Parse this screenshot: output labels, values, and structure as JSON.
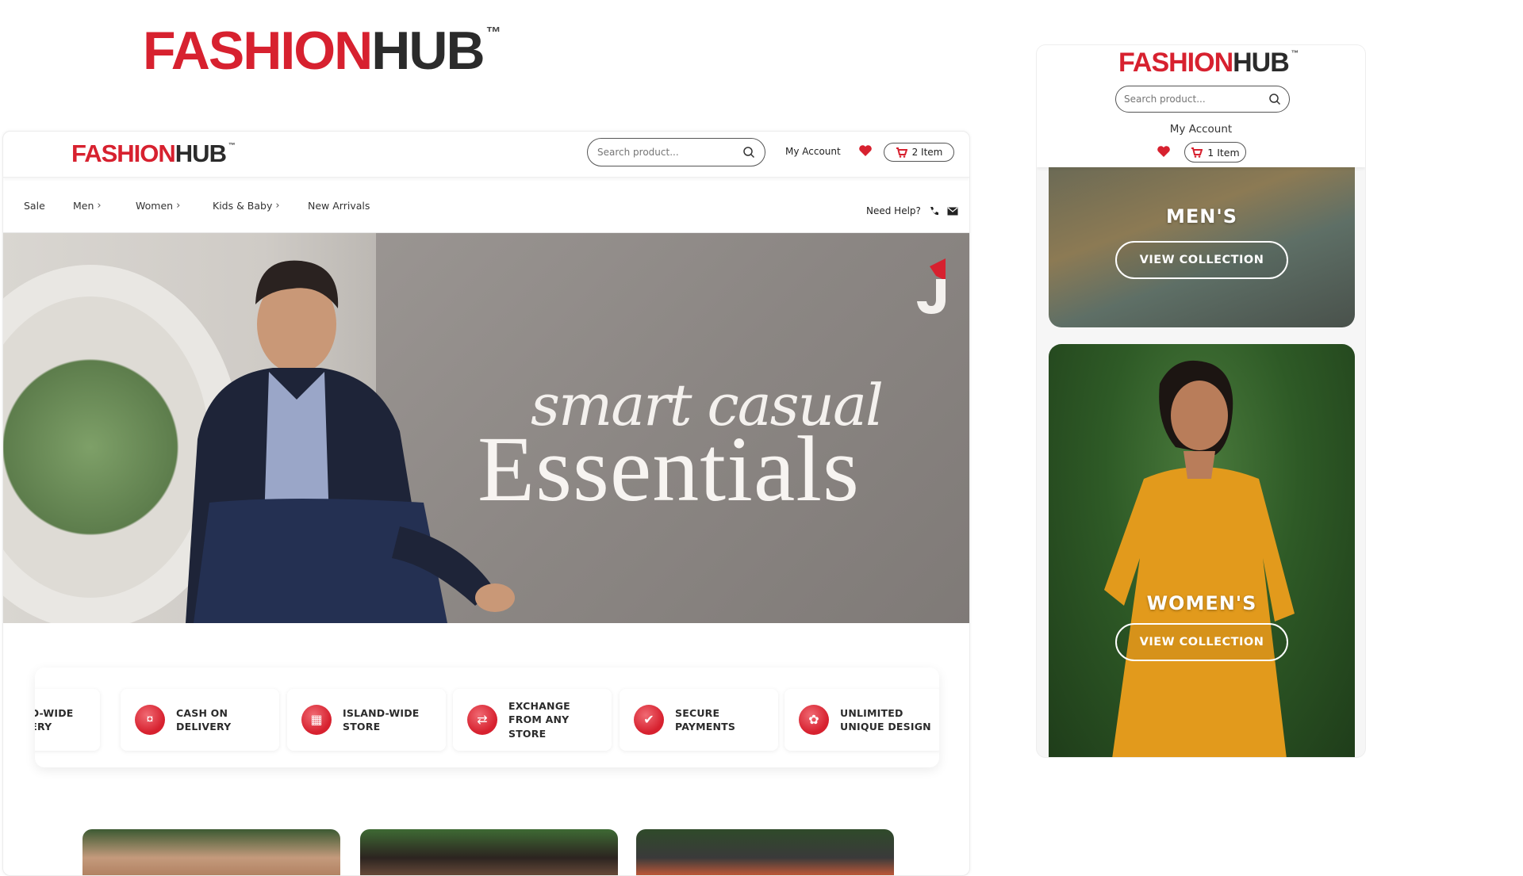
{
  "brand": {
    "logo_red": "FASHION",
    "logo_dark": "HUB",
    "tm": "™"
  },
  "desktop": {
    "search": {
      "placeholder": "Search product..."
    },
    "account_label": "My Account",
    "cart_label": "2 Item",
    "nav": {
      "items": [
        {
          "label": "Sale",
          "has_chevron": false
        },
        {
          "label": "Men",
          "has_chevron": true
        },
        {
          "label": "Women",
          "has_chevron": true
        },
        {
          "label": "Kids & Baby",
          "has_chevron": true
        },
        {
          "label": "New Arrivals",
          "has_chevron": false
        }
      ],
      "need_help": "Need Help?"
    },
    "hero": {
      "script_line": "smart casual",
      "headline": "Essentials"
    },
    "features": [
      {
        "label": "ISLAND-WIDE DELIVERY",
        "icon": "delivery-icon"
      },
      {
        "label": "CASH ON DELIVERY",
        "icon": "cash-icon"
      },
      {
        "label": "ISLAND-WIDE STORE",
        "icon": "store-icon"
      },
      {
        "label": "EXCHANGE FROM ANY STORE",
        "icon": "exchange-icon"
      },
      {
        "label": "SECURE PAYMENTS",
        "icon": "secure-payment-icon"
      },
      {
        "label": "UNLIMITED UNIQUE DESIGN",
        "icon": "design-icon"
      }
    ]
  },
  "mobile": {
    "search": {
      "placeholder": "Search product..."
    },
    "account_label": "My Account",
    "cart_label": "1 Item",
    "men": {
      "title": "MEN'S",
      "button": "VIEW COLLECTION"
    },
    "women": {
      "title": "WOMEN'S",
      "button": "VIEW COLLECTION"
    }
  },
  "colors": {
    "brand_red": "#d7212f",
    "brand_dark": "#2b2b2b"
  }
}
